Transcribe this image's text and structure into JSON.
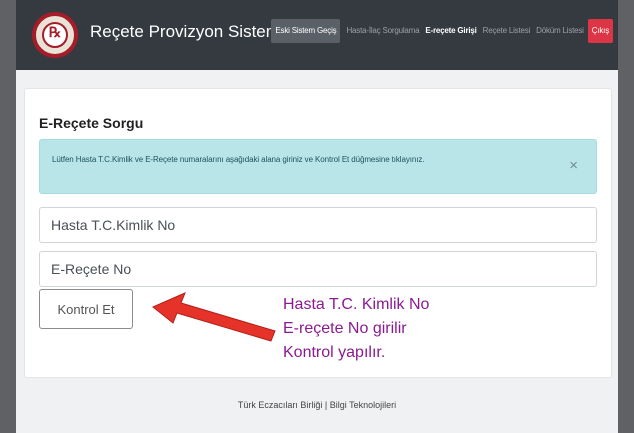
{
  "header": {
    "brand": "Reçete Provizyon Sistemi",
    "nav": [
      {
        "label": "Eski Sistem Geçiş",
        "state": "active"
      },
      {
        "label": "Hasta-İlaç Sorgulama",
        "state": "normal"
      },
      {
        "label": "E-reçete Girişi",
        "state": "bold"
      },
      {
        "label": "Reçete Listesi",
        "state": "normal"
      },
      {
        "label": "Döküm Listesi",
        "state": "normal"
      },
      {
        "label": "Çıkış",
        "state": "danger"
      }
    ]
  },
  "main": {
    "title": "E-Reçete Sorgu",
    "alert_text": "Lütfen Hasta T.C.Kimlik ve E-Reçete numaralarını aşağıdaki alana giriniz ve Kontrol Et düğmesine tıklayınız.",
    "alert_close": "×",
    "tc_placeholder": "Hasta T.C.Kimlik No",
    "erx_placeholder": "E-Reçete No",
    "kontrol_label": "Kontrol Et"
  },
  "annotation": {
    "lines": [
      "Hasta T.C. Kimlik No",
      "E-reçete No girilir",
      "Kontrol yapılır."
    ],
    "color": "#8b1a91",
    "arrow_color": "#e5332a"
  },
  "footer": {
    "text": "Türk Eczacıları Birliği | Bilgi Teknolojileri"
  }
}
